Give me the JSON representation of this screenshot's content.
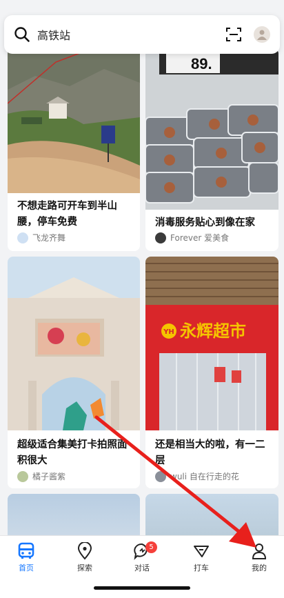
{
  "search": {
    "query": "高铁站"
  },
  "feed": [
    {
      "title": "不想走路可开车到半山腰，停车免费",
      "author": "飞龙齐舞"
    },
    {
      "title": "消毒服务贴心到像在家",
      "author": "Forever 爱美食",
      "price_tag": "89."
    },
    {
      "title": "超级适合集美打卡拍照面积很大",
      "author": "橘子酱紫"
    },
    {
      "title": "还是相当大的啦，有一二层",
      "author": "wuli 自在行走的花",
      "store_sign": "永辉超市",
      "store_logo": "YH"
    }
  ],
  "tabbar": [
    {
      "label": "首页"
    },
    {
      "label": "探索"
    },
    {
      "label": "对话",
      "badge": "5"
    },
    {
      "label": "打车"
    },
    {
      "label": "我的"
    }
  ],
  "colors": {
    "accent": "#1677ff",
    "badge": "#f5403b",
    "arrow": "#e8201c"
  }
}
